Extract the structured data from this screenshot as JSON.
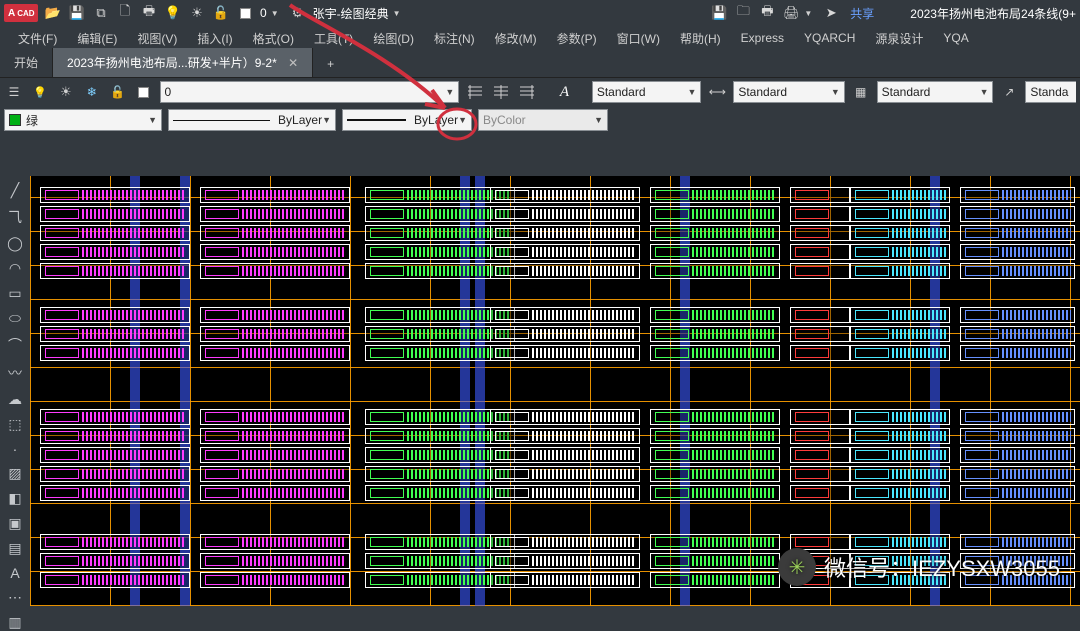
{
  "app_logo_text": "CAD",
  "qat_layer_value": "0",
  "workspace_setting_label": "张宇-绘图经典",
  "share_label": "共享",
  "doc_title": "2023年扬州电池布局24条线(9+",
  "menu": {
    "file": "文件(F)",
    "edit": "编辑(E)",
    "view": "视图(V)",
    "insert": "插入(I)",
    "format": "格式(O)",
    "tools": "工具(T)",
    "draw": "绘图(D)",
    "dimension": "标注(N)",
    "modify": "修改(M)",
    "parametric": "参数(P)",
    "window": "窗口(W)",
    "help": "帮助(H)",
    "express": "Express",
    "yqarch": "YQARCH",
    "yuanquan": "源泉设计",
    "yqa2": "YQA"
  },
  "tabs": {
    "start": "开始",
    "active": "2023年扬州电池布局...研发+半片）9-2*",
    "add": "+"
  },
  "props1": {
    "layer_name": "0",
    "layer_button_hatch": "图案填充",
    "text_style": "Standard",
    "dim_style": "Standard",
    "table_style": "Standard",
    "std_style": "Standa"
  },
  "props2": {
    "color_name": "绿",
    "linetype": "ByLayer",
    "lineweight": "ByLayer",
    "plotstyle": "ByColor"
  },
  "watermark": "微信号：IEZYSXW3055"
}
